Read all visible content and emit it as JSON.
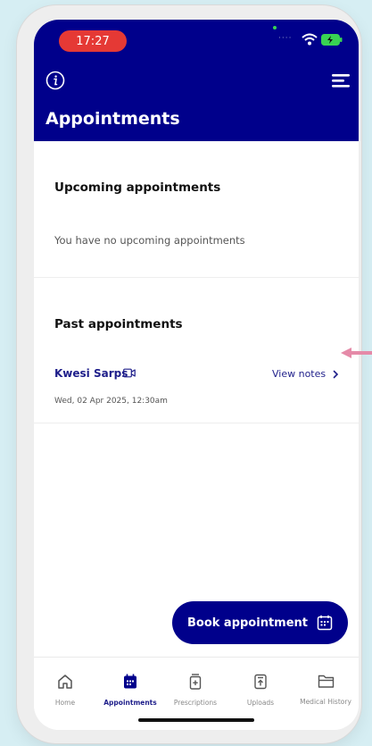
{
  "status_bar": {
    "time": "17:27"
  },
  "header": {
    "title": "Appointments"
  },
  "upcoming": {
    "title": "Upcoming appointments",
    "empty_text": "You have no upcoming appointments"
  },
  "past": {
    "title": "Past appointments",
    "items": [
      {
        "doctor": "Kwesi Sarps",
        "date": "Wed, 02 Apr 2025, 12:30am",
        "action": "View notes"
      }
    ]
  },
  "book_button": {
    "label": "Book appointment"
  },
  "tabs": [
    {
      "label": "Home",
      "icon": "home-icon",
      "active": false
    },
    {
      "label": "Appointments",
      "icon": "calendar-icon",
      "active": true
    },
    {
      "label": "Prescriptions",
      "icon": "prescription-icon",
      "active": false
    },
    {
      "label": "Uploads",
      "icon": "upload-icon",
      "active": false
    },
    {
      "label": "Medical History",
      "icon": "folder-icon",
      "active": false
    }
  ],
  "colors": {
    "brand": "#00008b",
    "accent_text": "#1e1e8a",
    "time_pill": "#e53935",
    "annotation_arrow": "#e58aa8"
  }
}
